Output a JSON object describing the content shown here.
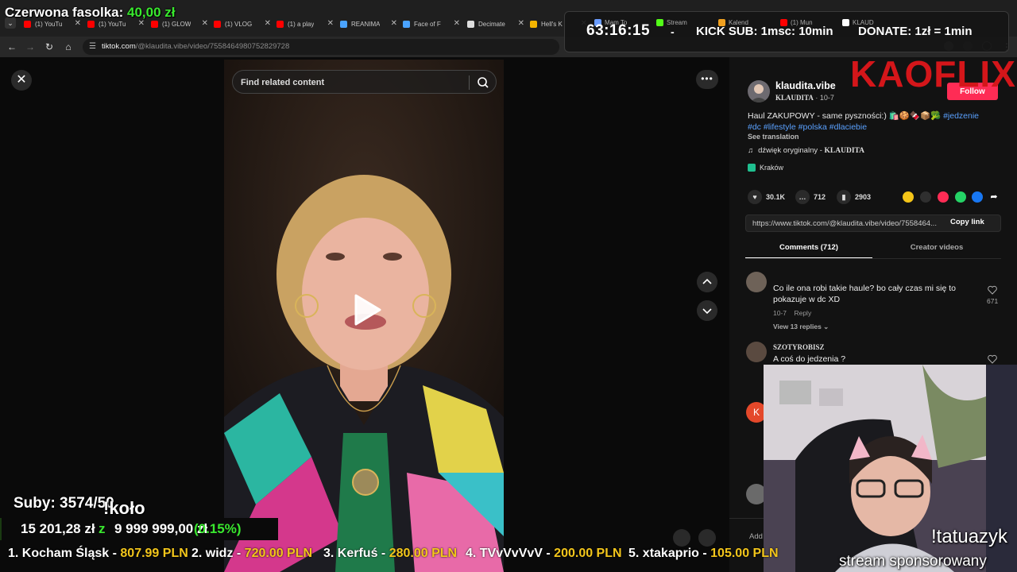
{
  "browser": {
    "tabs": [
      {
        "label": "(1) YouTu",
        "icon": "youtube-icon",
        "color": "#ff0000"
      },
      {
        "label": "(1) YouTu",
        "icon": "youtube-icon",
        "color": "#ff0000"
      },
      {
        "label": "(1) GLOW",
        "icon": "youtube-icon",
        "color": "#ff0000"
      },
      {
        "label": "(1) VLOG",
        "icon": "youtube-icon",
        "color": "#ff0000"
      },
      {
        "label": "(1) a play",
        "icon": "youtube-icon",
        "color": "#ff0000"
      },
      {
        "label": "REANIMA",
        "icon": "bird-icon",
        "color": "#4aa3ff"
      },
      {
        "label": "Face of F",
        "icon": "bird-icon",
        "color": "#4aa3ff"
      },
      {
        "label": "Decimate",
        "icon": "document-icon",
        "color": "#dddddd"
      },
      {
        "label": "Hell's K",
        "icon": "drive-icon",
        "color": "#f4b400"
      }
    ],
    "mini_tabs": [
      {
        "label": "Mam To",
        "color": "#6a9cff"
      },
      {
        "label": "Stream",
        "color": "#53fc18"
      },
      {
        "label": "Kalend",
        "color": "#f0a020"
      },
      {
        "label": "(1) Mun",
        "color": "#ff0000"
      },
      {
        "label": "KLAUD",
        "color": "#ffffff"
      }
    ],
    "url_host": "tiktok.com",
    "url_path": "/@klaudita.vibe/video/7558464980752829728"
  },
  "overlay": {
    "donor_name": "Czerwona fasolka: ",
    "donor_amount": "40,00 zł",
    "timer": "63:16:15",
    "timer_sep": "-",
    "kick_sub": "KICK SUB: 1msc: 10min",
    "donate": "DONATE: 1zł = 1min",
    "brand": "KAOFLIX",
    "suby": "Suby: 3574/50",
    "kolo": "!koło",
    "goal_current": "15 201,28 zł",
    "goal_z": "z",
    "goal_target": "9 999 999,00 zł",
    "goal_percent": "(0.15%)",
    "goal_fraction": 0.0015,
    "ticker": [
      {
        "name": "1. Kocham Śląsk - ",
        "amount": "807.99 PLN"
      },
      {
        "name": "2. widz - ",
        "amount": "720.00 PLN"
      },
      {
        "name": "3. Kerfuś - ",
        "amount": "280.00 PLN"
      },
      {
        "name": "4. TVvVvVvV - ",
        "amount": "200.00 PLN"
      },
      {
        "name": "5. xtakaprio - ",
        "amount": "105.00 PLN"
      }
    ],
    "cam_text1": "!tatuazyk",
    "cam_text2": "stream sponsorowany"
  },
  "player": {
    "search_placeholder": "Find related content"
  },
  "post": {
    "username": "klaudita.vibe",
    "display_name": "KLAUDITA",
    "date": " · 10-7",
    "follow": "Follow",
    "desc_text": "Haul ZAKUPOWY - same pyszności:) 🛍️🍪🍫📦🥦 ",
    "tags": [
      "#jedzenie",
      "#dc",
      "#lifestyle",
      "#polska",
      "#dlaciebie"
    ],
    "see_translation": "See translation",
    "music_prefix": "dźwięk oryginalny - ",
    "music_author": "KLAUDITA",
    "location": "Kraków",
    "likes": "30.1K",
    "comments": "712",
    "saves": "2903",
    "link": "https://www.tiktok.com/@klaudita.vibe/video/7558464...",
    "copy_link": "Copy link",
    "tab_comments": "Comments (712)",
    "tab_creator": "Creator videos"
  },
  "comments": [
    {
      "text": "Co ile ona robi takie haule? bo cały czas mi się to pokazuje w dc XD",
      "date": "10-7",
      "reply": "Reply",
      "replies": "View 13 replies",
      "likes": "671"
    },
    {
      "name": "SZOTYROBISZ",
      "text": "A coś do jedzenia ?"
    }
  ],
  "add_comment": "Add"
}
